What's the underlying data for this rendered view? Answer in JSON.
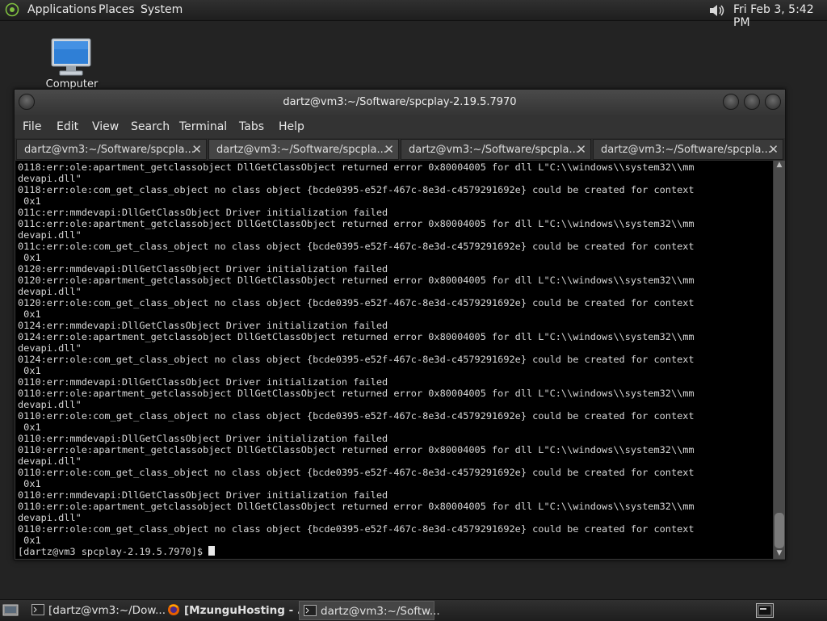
{
  "top_panel": {
    "menus": [
      "Applications",
      "Places",
      "System"
    ],
    "clock": "Fri Feb  3,  5:42 PM"
  },
  "desktop": {
    "computer_label": "Computer"
  },
  "terminal": {
    "title": "dartz@vm3:~/Software/spcplay-2.19.5.7970",
    "menu": {
      "file": "File",
      "edit": "Edit",
      "view": "View",
      "search": "Search",
      "terminal": "Terminal",
      "tabs": "Tabs",
      "help": "Help"
    },
    "tabs": [
      {
        "label": "dartz@vm3:~/Software/spcpla..."
      },
      {
        "label": "dartz@vm3:~/Software/spcpla..."
      },
      {
        "label": "dartz@vm3:~/Software/spcpla..."
      },
      {
        "label": "dartz@vm3:~/Software/spcpla..."
      }
    ],
    "close_glyph": "✕",
    "output": "0118:err:ole:apartment_getclassobject DllGetClassObject returned error 0x80004005 for dll L\"C:\\\\windows\\\\system32\\\\mm\ndevapi.dll\"\n0118:err:ole:com_get_class_object no class object {bcde0395-e52f-467c-8e3d-c4579291692e} could be created for context\n 0x1\n011c:err:mmdevapi:DllGetClassObject Driver initialization failed\n011c:err:ole:apartment_getclassobject DllGetClassObject returned error 0x80004005 for dll L\"C:\\\\windows\\\\system32\\\\mm\ndevapi.dll\"\n011c:err:ole:com_get_class_object no class object {bcde0395-e52f-467c-8e3d-c4579291692e} could be created for context\n 0x1\n0120:err:mmdevapi:DllGetClassObject Driver initialization failed\n0120:err:ole:apartment_getclassobject DllGetClassObject returned error 0x80004005 for dll L\"C:\\\\windows\\\\system32\\\\mm\ndevapi.dll\"\n0120:err:ole:com_get_class_object no class object {bcde0395-e52f-467c-8e3d-c4579291692e} could be created for context\n 0x1\n0124:err:mmdevapi:DllGetClassObject Driver initialization failed\n0124:err:ole:apartment_getclassobject DllGetClassObject returned error 0x80004005 for dll L\"C:\\\\windows\\\\system32\\\\mm\ndevapi.dll\"\n0124:err:ole:com_get_class_object no class object {bcde0395-e52f-467c-8e3d-c4579291692e} could be created for context\n 0x1\n0110:err:mmdevapi:DllGetClassObject Driver initialization failed\n0110:err:ole:apartment_getclassobject DllGetClassObject returned error 0x80004005 for dll L\"C:\\\\windows\\\\system32\\\\mm\ndevapi.dll\"\n0110:err:ole:com_get_class_object no class object {bcde0395-e52f-467c-8e3d-c4579291692e} could be created for context\n 0x1\n0110:err:mmdevapi:DllGetClassObject Driver initialization failed\n0110:err:ole:apartment_getclassobject DllGetClassObject returned error 0x80004005 for dll L\"C:\\\\windows\\\\system32\\\\mm\ndevapi.dll\"\n0110:err:ole:com_get_class_object no class object {bcde0395-e52f-467c-8e3d-c4579291692e} could be created for context\n 0x1\n0110:err:mmdevapi:DllGetClassObject Driver initialization failed\n0110:err:ole:apartment_getclassobject DllGetClassObject returned error 0x80004005 for dll L\"C:\\\\windows\\\\system32\\\\mm\ndevapi.dll\"\n0110:err:ole:com_get_class_object no class object {bcde0395-e52f-467c-8e3d-c4579291692e} could be created for context\n 0x1",
    "prompt": "[dartz@vm3 spcplay-2.19.5.7970]$ "
  },
  "taskbar": {
    "items": [
      {
        "label": "[dartz@vm3:~/Dow..."
      },
      {
        "label": "[MzunguHosting - ..."
      },
      {
        "label": "dartz@vm3:~/Softw..."
      }
    ]
  },
  "colors": {
    "panel_bg": "#262626",
    "terminal_bg": "#000000",
    "terminal_fg": "#d8d8d8",
    "desktop_bg": "#232323"
  }
}
